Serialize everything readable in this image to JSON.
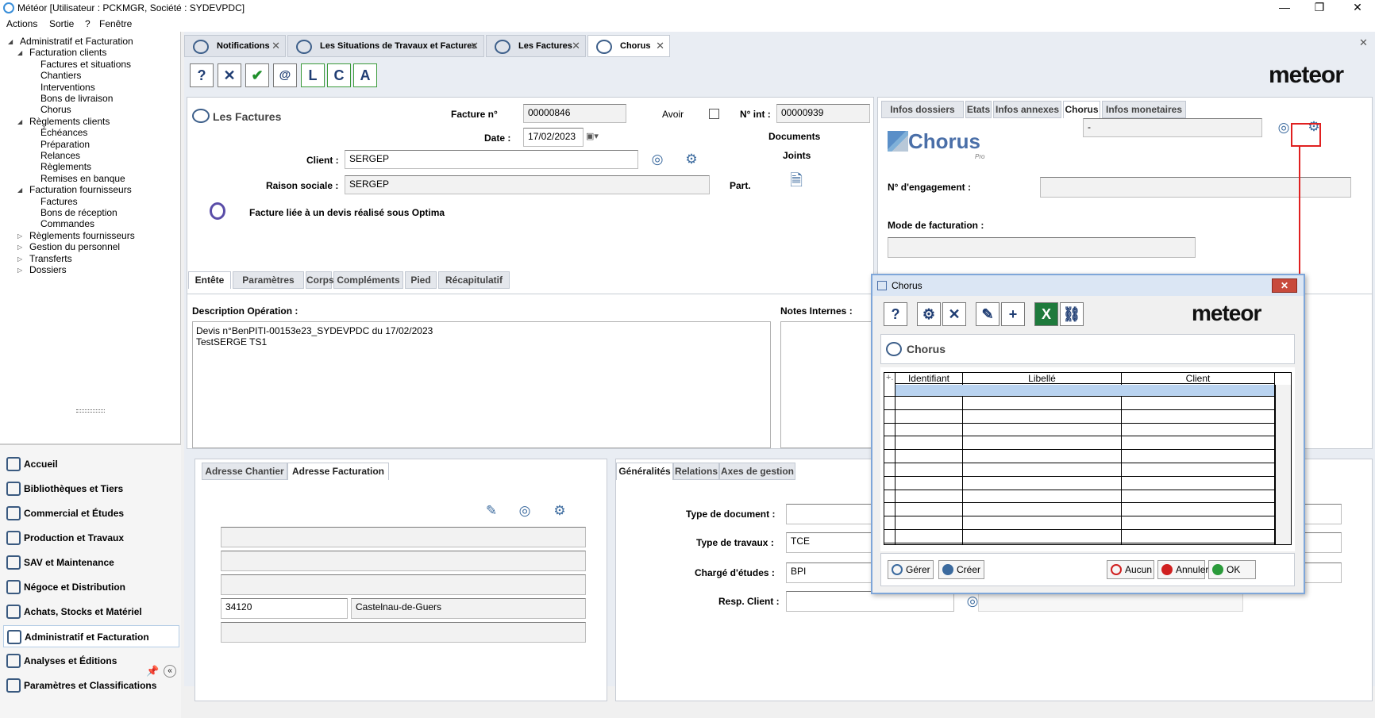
{
  "window": {
    "title": "Météor [Utilisateur : PCKMGR, Société : SYDEVPDC]",
    "minimize": "—",
    "restore": "❐",
    "close": "✕"
  },
  "menu": [
    "Actions",
    "Sortie",
    "?",
    "Fenêtre"
  ],
  "tree": [
    {
      "label": "Administratif et Facturation",
      "level": 0,
      "arrow": "◢"
    },
    {
      "label": "Facturation clients",
      "level": 1,
      "arrow": "◢"
    },
    {
      "label": "Factures et situations",
      "level": 2
    },
    {
      "label": "Chantiers",
      "level": 2
    },
    {
      "label": "Interventions",
      "level": 2
    },
    {
      "label": "Bons de livraison",
      "level": 2
    },
    {
      "label": "Chorus",
      "level": 2
    },
    {
      "label": "Règlements clients",
      "level": 1,
      "arrow": "◢"
    },
    {
      "label": "Échéances",
      "level": 2
    },
    {
      "label": "Préparation",
      "level": 2
    },
    {
      "label": "Relances",
      "level": 2
    },
    {
      "label": "Règlements",
      "level": 2
    },
    {
      "label": "Remises en banque",
      "level": 2
    },
    {
      "label": "Facturation fournisseurs",
      "level": 1,
      "arrow": "◢"
    },
    {
      "label": "Factures",
      "level": 2
    },
    {
      "label": "Bons de réception",
      "level": 2
    },
    {
      "label": "Commandes",
      "level": 2
    },
    {
      "label": "Règlements fournisseurs",
      "level": 1,
      "arrow": "▷"
    },
    {
      "label": "Gestion du personnel",
      "level": 1,
      "arrow": "▷"
    },
    {
      "label": "Transferts",
      "level": 1,
      "arrow": "▷"
    },
    {
      "label": "Dossiers",
      "level": 1,
      "arrow": "▷"
    }
  ],
  "modules": [
    "Accueil",
    "Bibliothèques et Tiers",
    "Commercial et Études",
    "Production et Travaux",
    "SAV et Maintenance",
    "Négoce et Distribution",
    "Achats, Stocks et Matériel",
    "Administratif et Facturation",
    "Analyses et Éditions",
    "Paramètres et Classifications"
  ],
  "tabs": [
    {
      "label": "Notifications"
    },
    {
      "label": "Les Situations de Travaux et Factures"
    },
    {
      "label": "Les Factures"
    },
    {
      "label": "Chorus"
    }
  ],
  "toolbar": {
    "help": "?",
    "cancel": "✕",
    "ok": "✔",
    "note": "@",
    "l": "L",
    "c": "C",
    "a": "A"
  },
  "brand": "meteor",
  "factures": {
    "title": "Les Factures",
    "facture_label": "Facture n°",
    "facture_value": "00000846",
    "avoir_label": "Avoir",
    "nint_label": "N° int :",
    "nint_value": "00000939",
    "date_label": "Date :",
    "date_value": "17/02/2023",
    "documents_label": "Documents",
    "joints_label": "Joints",
    "client_label": "Client :",
    "client_value": "SERGEP",
    "raison_label": "Raison sociale :",
    "raison_value": "SERGEP",
    "part_label": "Part.",
    "devis_note": "Facture liée à un devis réalisé sous Optima"
  },
  "right_tabs": [
    "Infos dossiers",
    "Etats",
    "Infos annexes",
    "Chorus",
    "Infos monetaires"
  ],
  "chorus_panel": {
    "logo_text": "Chorus",
    "logo_sub": "Pro",
    "field_value": "-",
    "engagement_label": "N° d'engagement :",
    "mode_label": "Mode de facturation :"
  },
  "entete_tabs": [
    "Entête",
    "Paramètres",
    "Corps",
    "Compléments",
    "Pied",
    "Récapitulatif"
  ],
  "description": {
    "label": "Description Opération :",
    "value": "Devis n°BenPITI-00153e23_SYDEVPDC du 17/02/2023\nTestSERGE TS1",
    "notes_label": "Notes Internes :"
  },
  "address_tabs": [
    "Adresse Chantier",
    "Adresse Facturation"
  ],
  "address": {
    "cp": "34120",
    "city": "Castelnau-de-Guers"
  },
  "gen_tabs": [
    "Généralités",
    "Relations",
    "Axes de gestion"
  ],
  "general": {
    "type_doc_label": "Type de document :",
    "type_trav_label": "Type de travaux :",
    "type_trav_value": "TCE",
    "charge_label": "Chargé d'études :",
    "charge_value": "BPI",
    "resp_label": "Resp. Client :"
  },
  "dialog": {
    "title": "Chorus",
    "close": "✕",
    "header": "Chorus",
    "columns": [
      "Identifiant",
      "Libellé",
      "Client"
    ],
    "buttons": {
      "gerer": "Gérer",
      "creer": "Créer",
      "aucun": "Aucun",
      "annuler": "Annuler",
      "ok": "OK"
    }
  }
}
